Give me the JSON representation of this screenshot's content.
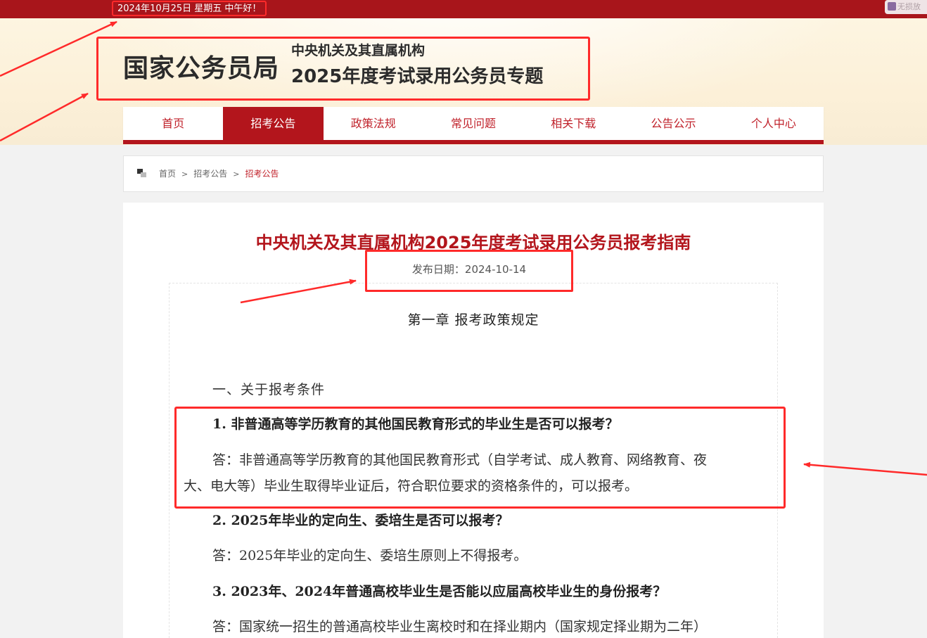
{
  "topbar": {
    "date_greeting": "2024年10月25日  星期五  中午好！",
    "plugin_label": "无损放"
  },
  "header": {
    "site_name": "国家公务员局",
    "subtitle_line1": "中央机关及其直属机构",
    "subtitle_line2": "2025年度考试录用公务员专题"
  },
  "nav": {
    "items": [
      {
        "label": "首页"
      },
      {
        "label": "招考公告"
      },
      {
        "label": "政策法规"
      },
      {
        "label": "常见问题"
      },
      {
        "label": "相关下载"
      },
      {
        "label": "公告公示"
      },
      {
        "label": "个人中心"
      }
    ],
    "active_index": 1
  },
  "breadcrumb": {
    "home": "首页",
    "sep": ">",
    "level1": "招考公告",
    "current": "招考公告"
  },
  "article": {
    "title": "中央机关及其直属机构2025年度考试录用公务员报考指南",
    "publish_date": "发布日期：2024-10-14",
    "chapter": "第一章  报考政策规定",
    "section": "一、关于报考条件",
    "q1": "1. 非普通高等学历教育的其他国民教育形式的毕业生是否可以报考？",
    "a1_line1": "答：非普通高等学历教育的其他国民教育形式（自学考试、成人教育、网络教育、夜",
    "a1_line2": "大、电大等）毕业生取得毕业证后，符合职位要求的资格条件的，可以报考。",
    "q2": "2. 2025年毕业的定向生、委培生是否可以报考？",
    "a2": "答：2025年毕业的定向生、委培生原则上不得报考。",
    "q3": "3. 2023年、2024年普通高校毕业生是否能以应届高校毕业生的身份报考？",
    "a3_line1": "答：国家统一招生的普通高校毕业生离校时和在择业期内（国家规定择业期为二年）"
  },
  "colors": {
    "brand_red": "#b3151c",
    "annotation_red": "#ff2a2a"
  }
}
